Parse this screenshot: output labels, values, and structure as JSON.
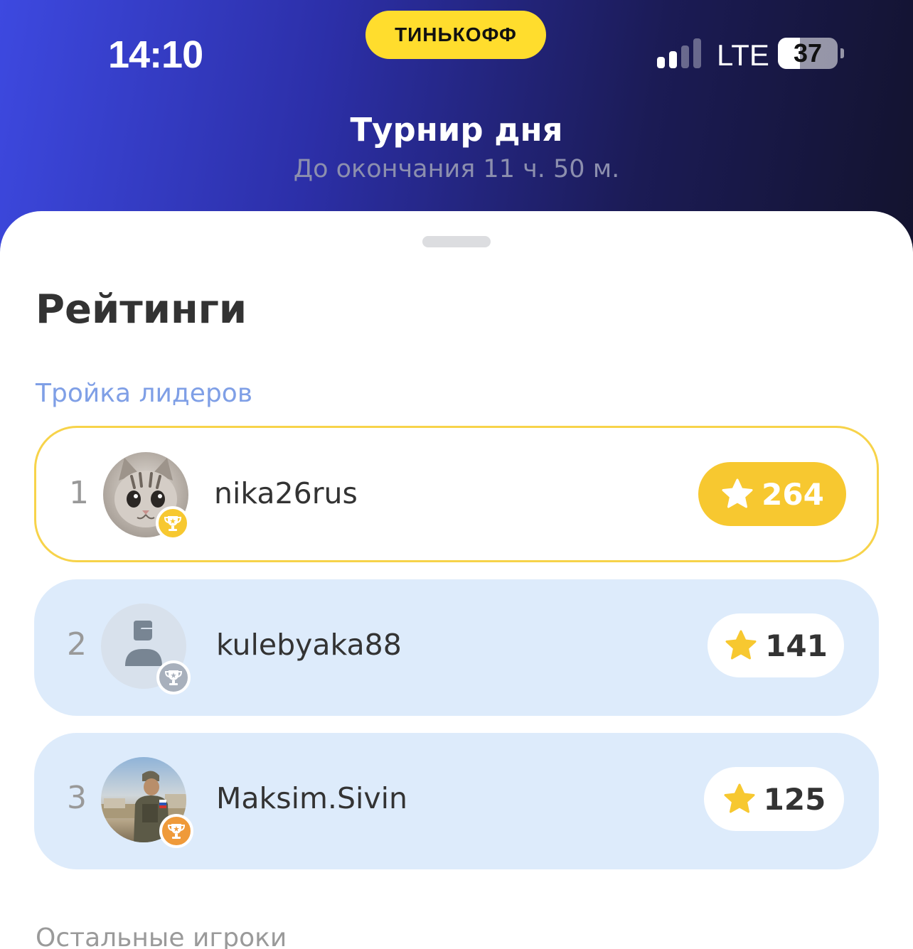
{
  "status_bar": {
    "time": "14:10",
    "brand": "ТИНЬКОФФ",
    "network": "LTE",
    "battery": "37",
    "battery_level": 0.37,
    "signal_bars_active": 2,
    "signal_bars_total": 4
  },
  "header": {
    "title": "Турнир дня",
    "subtitle": "До окончания 11 ч. 50 м."
  },
  "ratings": {
    "title": "Рейтинги",
    "leaders_label": "Тройка лидеров",
    "others_label": "Остальные игроки",
    "leaders": [
      {
        "rank": "1",
        "username": "nika26rus",
        "score": "264",
        "medal": "gold",
        "avatar": "cat-photo"
      },
      {
        "rank": "2",
        "username": "kulebyaka88",
        "score": "141",
        "medal": "silver",
        "avatar": "default-user"
      },
      {
        "rank": "3",
        "username": "Maksim.Sivin",
        "score": "125",
        "medal": "bronze",
        "avatar": "soldier-photo"
      }
    ]
  },
  "colors": {
    "accent_yellow": "#f7c830",
    "brand_yellow": "#ffdd2d",
    "row_blue": "#ddebfb",
    "label_blue": "#7f9fe6",
    "medal_silver": "#a8b0bc",
    "medal_bronze": "#ef9a3a"
  },
  "icons": {
    "star": "star-icon",
    "trophy": "trophy-icon",
    "user": "user-icon"
  }
}
